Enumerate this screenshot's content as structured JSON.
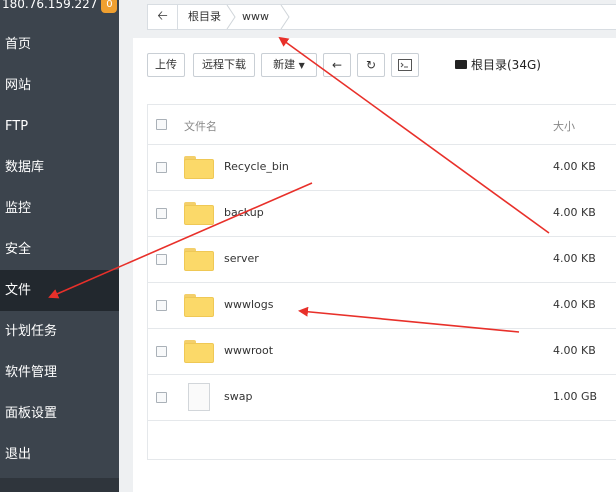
{
  "sidebar": {
    "ip": "180.76.159.227",
    "badge": "0",
    "items": [
      {
        "label": "首页"
      },
      {
        "label": "网站"
      },
      {
        "label": "FTP"
      },
      {
        "label": "数据库"
      },
      {
        "label": "监控"
      },
      {
        "label": "安全"
      },
      {
        "label": "文件"
      },
      {
        "label": "计划任务"
      },
      {
        "label": "软件管理"
      },
      {
        "label": "面板设置"
      },
      {
        "label": "退出"
      }
    ],
    "active_item": "文件"
  },
  "breadcrumb": {
    "back_icon": "arrow-left-icon",
    "crumbs": [
      "根目录",
      "www"
    ]
  },
  "toolbar": {
    "upload": "上传",
    "remote_download": "远程下载",
    "new": "新建",
    "disk_label": "根目录(34G)"
  },
  "table": {
    "headers": {
      "name": "文件名",
      "size": "大小"
    },
    "rows": [
      {
        "name": "Recycle_bin",
        "size": "4.00 KB",
        "type": "folder"
      },
      {
        "name": "backup",
        "size": "4.00 KB",
        "type": "folder"
      },
      {
        "name": "server",
        "size": "4.00 KB",
        "type": "folder"
      },
      {
        "name": "wwwlogs",
        "size": "4.00 KB",
        "type": "folder"
      },
      {
        "name": "wwwroot",
        "size": "4.00 KB",
        "type": "folder"
      },
      {
        "name": "swap",
        "size": "1.00 GB",
        "type": "file"
      }
    ]
  },
  "colors": {
    "sidebar_bg": "#3c444d",
    "sidebar_active_bg": "#22282e",
    "badge": "#f0a030",
    "folder": "#fbd969",
    "annotation_arrow": "#e8302a"
  }
}
